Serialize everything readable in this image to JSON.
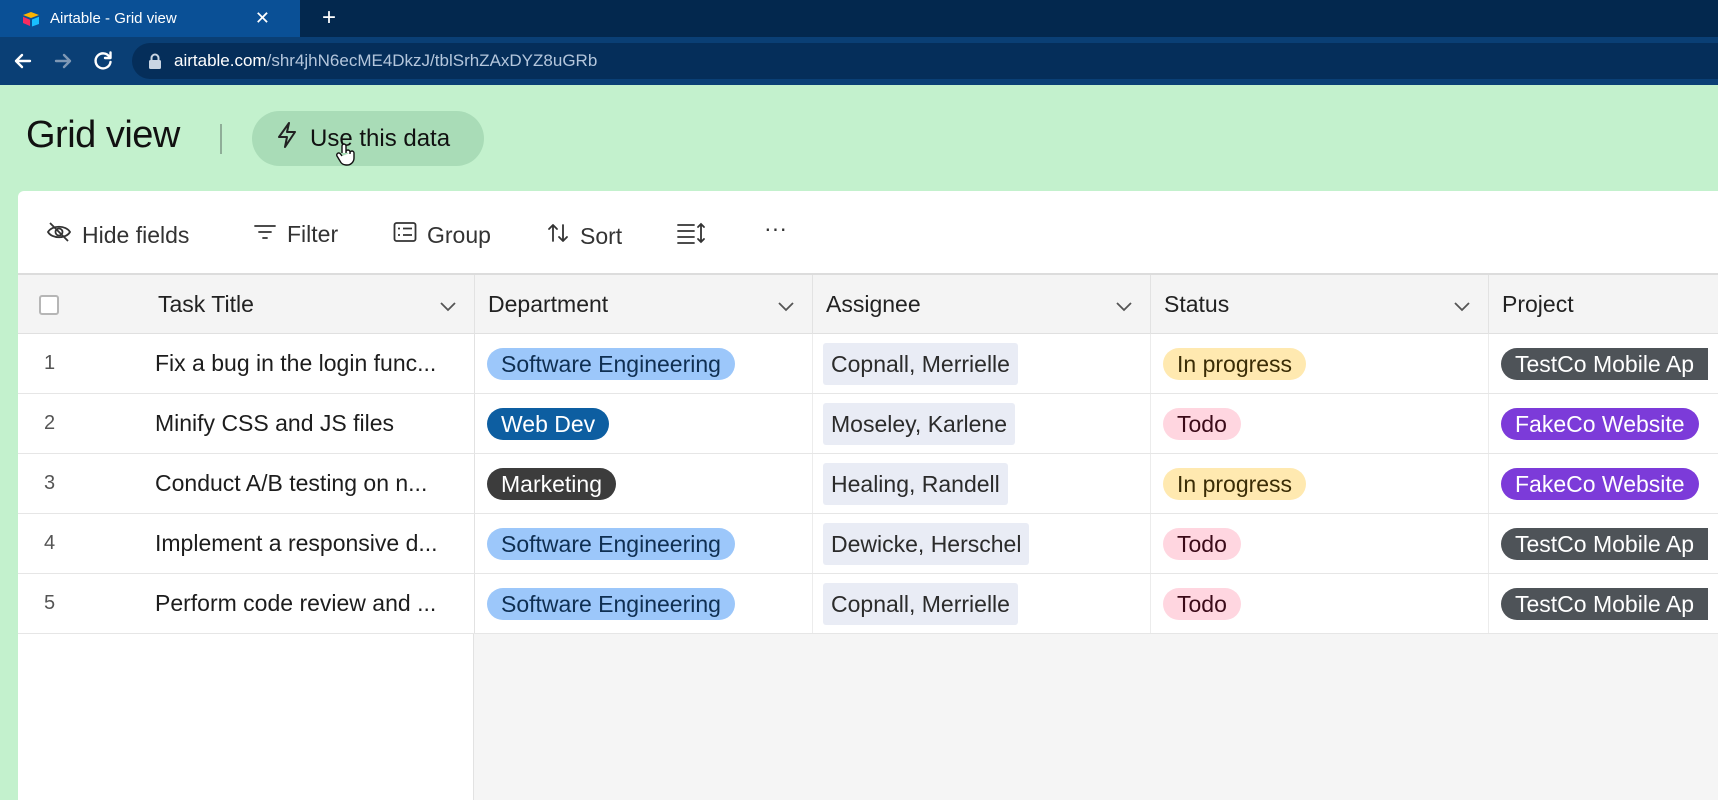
{
  "browser": {
    "tab_title": "Airtable - Grid view",
    "tab_close": "✕",
    "new_tab": "+",
    "url_host": "airtable.com",
    "url_path": "/shr4jhN6ecME4DkzJ/tblSrhZAxDYZ8uGRb"
  },
  "header": {
    "title": "Grid view",
    "use_data_label": "Use this data"
  },
  "toolbar": {
    "hide_fields": "Hide fields",
    "filter": "Filter",
    "group": "Group",
    "sort": "Sort",
    "more": "···"
  },
  "columns": {
    "task_title": "Task Title",
    "department": "Department",
    "assignee": "Assignee",
    "status": "Status",
    "project": "Project"
  },
  "rows": [
    {
      "num": "1",
      "title": "Fix a bug in the login func...",
      "department": "Software Engineering",
      "assignee": "Copnall, Merrielle",
      "status": "In progress",
      "project": "TestCo Mobile Ap"
    },
    {
      "num": "2",
      "title": "Minify CSS and JS files",
      "department": "Web Dev",
      "assignee": "Moseley, Karlene",
      "status": "Todo",
      "project": "FakeCo Website"
    },
    {
      "num": "3",
      "title": "Conduct A/B testing on n...",
      "department": "Marketing",
      "assignee": "Healing, Randell",
      "status": "In progress",
      "project": "FakeCo Website"
    },
    {
      "num": "4",
      "title": "Implement a responsive d...",
      "department": "Software Engineering",
      "assignee": "Dewicke, Herschel",
      "status": "Todo",
      "project": "TestCo Mobile Ap"
    },
    {
      "num": "5",
      "title": "Perform code review and ...",
      "department": "Software Engineering",
      "assignee": "Copnall, Merrielle",
      "status": "Todo",
      "project": "TestCo Mobile Ap"
    }
  ],
  "colors": {
    "page_background": "#c3f1cd",
    "software_engineering": "#9cc7fa",
    "web_dev": "#0d5ea1",
    "marketing": "#3c3c3c",
    "in_progress": "#ffe9b0",
    "todo": "#ffd6e0",
    "testco": "#4e5358",
    "fakeco": "#7c3bd9"
  }
}
